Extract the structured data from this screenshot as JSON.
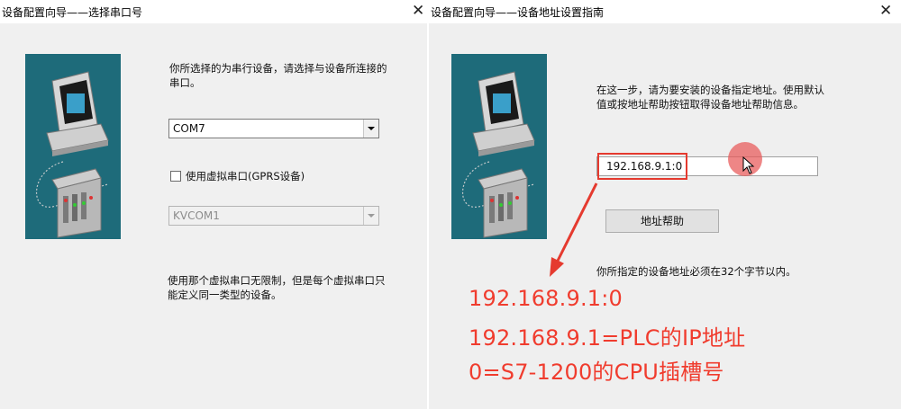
{
  "left_dialog": {
    "title": "设备配置向导——选择串口号",
    "description": "你所选择的为串行设备，请选择与设备所连接的串口。",
    "com_port": "COM7",
    "virtual_port_checkbox_label": "使用虚拟串口(GPRS设备)",
    "virtual_port_checked": false,
    "virtual_com": "KVCOM1",
    "note": "使用那个虚拟串口无限制，但是每个虚拟串口只能定义同一类型的设备。",
    "close_icon": "close-icon"
  },
  "right_dialog": {
    "title": "设备配置向导——设备地址设置指南",
    "description": "在这一步，请为要安装的设备指定地址。使用默认值或按地址帮助按钮取得设备地址帮助信息。",
    "address_value": "192.168.9.1:0",
    "address_help_button": "地址帮助",
    "length_note": "你所指定的设备地址必须在32个字节以内。",
    "close_icon": "close-icon"
  },
  "annotation": {
    "line1": "192.168.9.1:0",
    "line2": "192.168.9.1=PLC的IP地址",
    "line3": "0=S7-1200的CPU插槽号",
    "color": "#f03c2e"
  },
  "colors": {
    "illustration_bg": "#1e6b7a",
    "highlight_red": "#e53a2f"
  }
}
